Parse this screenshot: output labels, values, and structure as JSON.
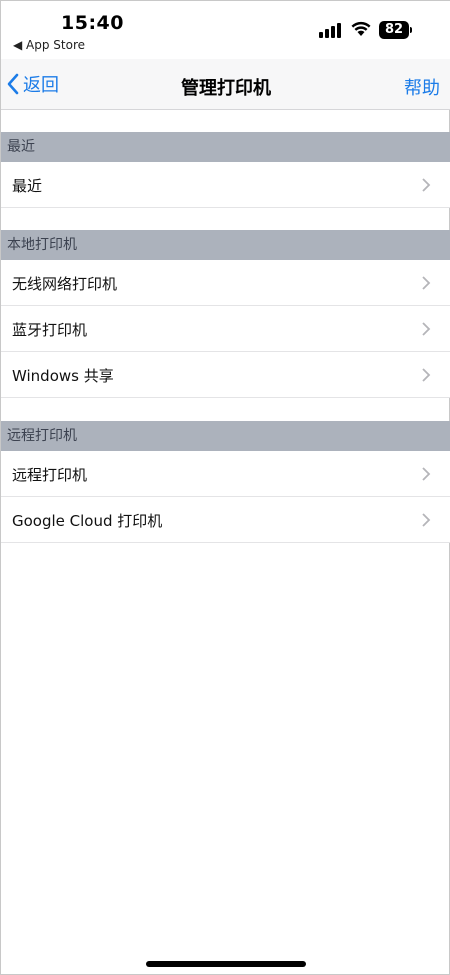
{
  "status_bar": {
    "time": "15:40",
    "back_app": "◀ App Store",
    "battery": "82"
  },
  "nav": {
    "back_label": "返回",
    "title": "管理打印机",
    "help_label": "帮助"
  },
  "sections": [
    {
      "header": "最近",
      "rows": [
        {
          "label": "最近"
        }
      ]
    },
    {
      "header": "本地打印机",
      "rows": [
        {
          "label": "无线网络打印机"
        },
        {
          "label": "蓝牙打印机"
        },
        {
          "label": "Windows 共享"
        }
      ]
    },
    {
      "header": "远程打印机",
      "rows": [
        {
          "label": "远程打印机"
        },
        {
          "label": "Google Cloud 打印机"
        }
      ]
    }
  ],
  "colors": {
    "accent": "#1c7ce8",
    "section_bg": "#acb2bc"
  },
  "icons": {
    "back": "chevron-left-icon",
    "row": "chevron-right-icon",
    "wifi": "wifi-icon",
    "signal": "cellular-signal-icon",
    "battery": "battery-icon"
  }
}
